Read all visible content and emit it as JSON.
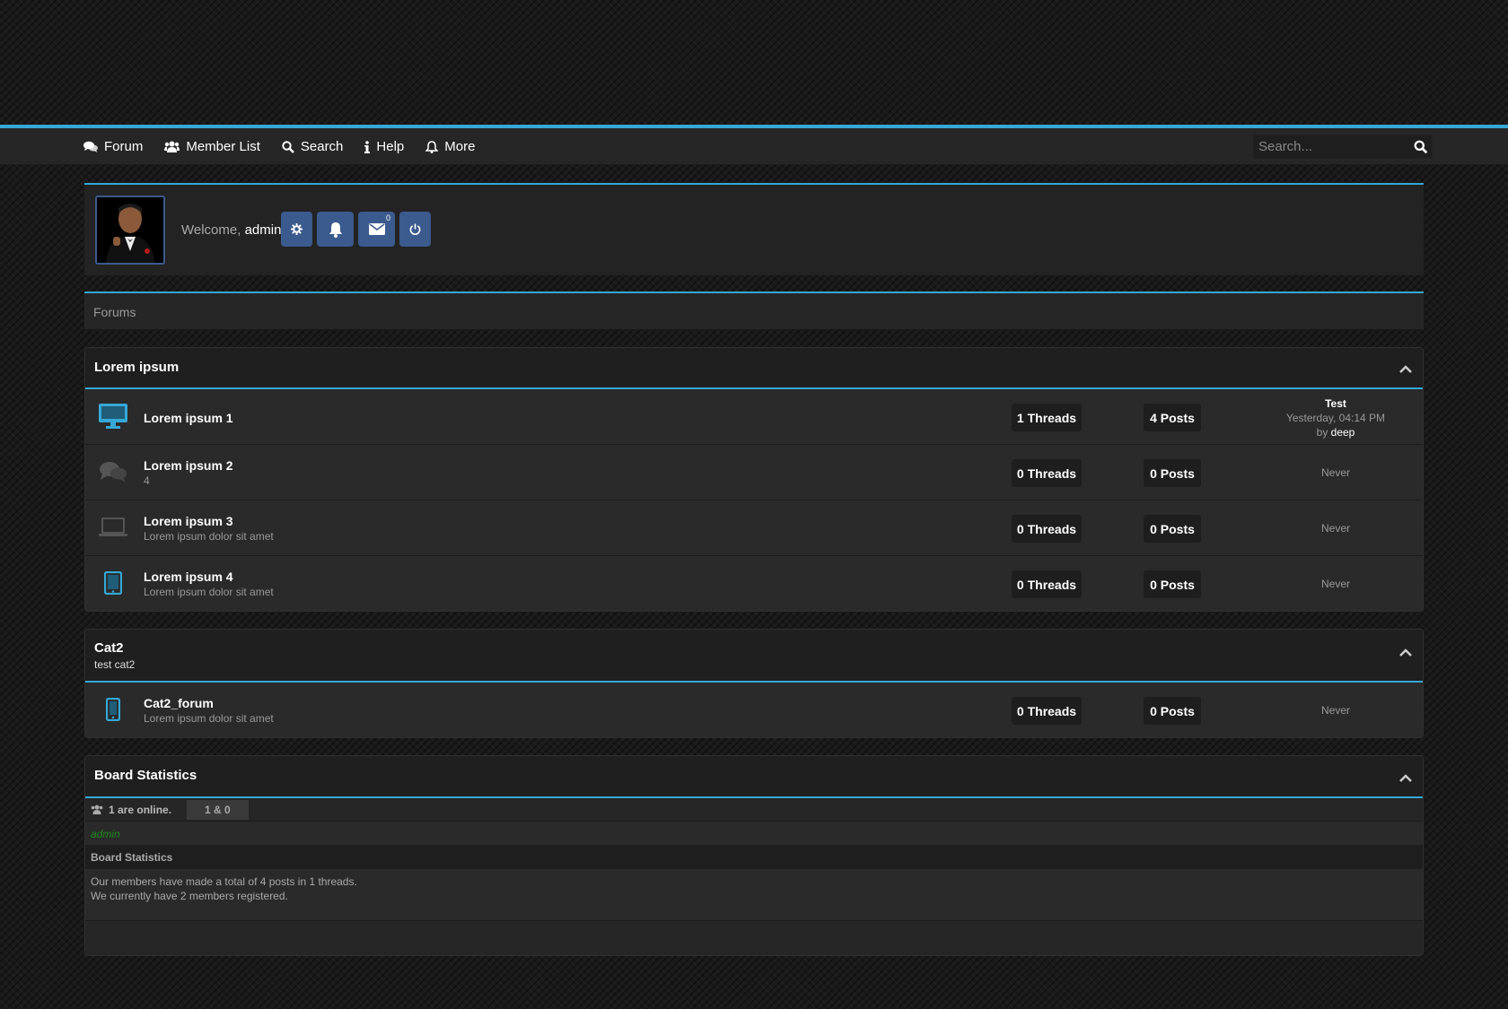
{
  "nav": {
    "items": [
      {
        "label": "Forum",
        "icon": "comments-icon"
      },
      {
        "label": "Member List",
        "icon": "users-icon"
      },
      {
        "label": "Search",
        "icon": "search-icon"
      },
      {
        "label": "Help",
        "icon": "info-icon"
      },
      {
        "label": "More",
        "icon": "bell-icon"
      }
    ],
    "search_placeholder": "Search..."
  },
  "welcome": {
    "prefix": "Welcome, ",
    "username": "admin",
    "messages_badge": "0"
  },
  "breadcrumb": "Forums",
  "categories": [
    {
      "title": "Lorem ipsum",
      "forums": [
        {
          "name": "Lorem ipsum 1",
          "description": "",
          "icon": "monitor-icon",
          "threads": "1 Threads",
          "posts": "4 Posts",
          "lastpost": {
            "title": "Test",
            "date": "Yesterday, 04:14 PM",
            "by_prefix": "by ",
            "by_user": "deep"
          }
        },
        {
          "name": "Lorem ipsum 2",
          "description": "4",
          "icon": "comments-icon",
          "threads": "0 Threads",
          "posts": "0 Posts",
          "lastpost_never": "Never"
        },
        {
          "name": "Lorem ipsum 3",
          "description": "Lorem ipsum dolor sit amet",
          "icon": "laptop-icon",
          "threads": "0 Threads",
          "posts": "0 Posts",
          "lastpost_never": "Never"
        },
        {
          "name": "Lorem ipsum 4",
          "description": "Lorem ipsum dolor sit amet",
          "icon": "tablet-icon",
          "threads": "0 Threads",
          "posts": "0 Posts",
          "lastpost_never": "Never"
        }
      ]
    },
    {
      "title": "Cat2",
      "subtitle": "test cat2",
      "forums": [
        {
          "name": "Cat2_forum",
          "description": "Lorem ipsum dolor sit amet",
          "icon": "mobile-icon",
          "threads": "0 Threads",
          "posts": "0 Posts",
          "lastpost_never": "Never"
        }
      ]
    }
  ],
  "board_stats": {
    "title": "Board Statistics",
    "online_text": "1 are online.",
    "online_count": "1 & 0",
    "online_users": "admin",
    "sub_title": "Board Statistics",
    "line1": "Our members have made a total of 4 posts in 1 threads.",
    "line2": "We currently have 2 members registered."
  },
  "colors": {
    "accent": "#36a8d6",
    "button": "#3b5a8e",
    "online_user": "#1e8c1e"
  }
}
